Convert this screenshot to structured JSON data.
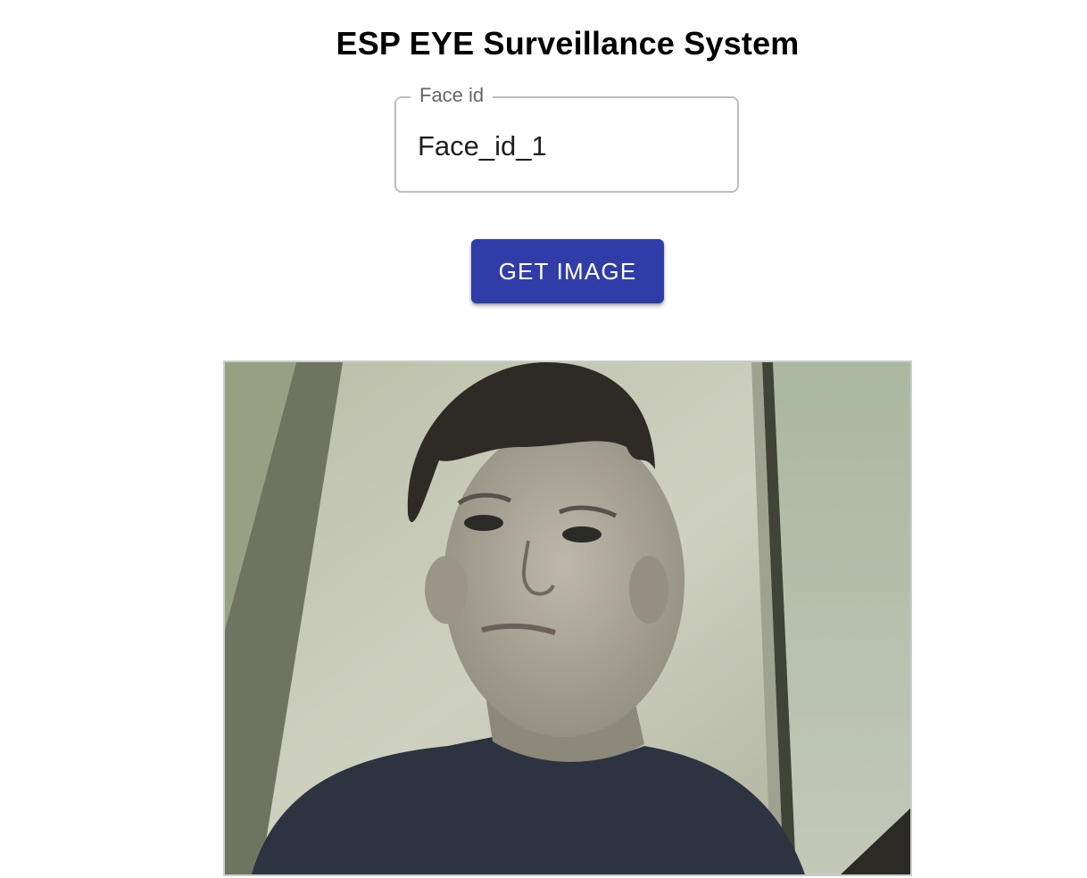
{
  "header": {
    "title": "ESP EYE Surveillance System"
  },
  "face_id_field": {
    "label": "Face id",
    "value": "Face_id_1"
  },
  "actions": {
    "get_image_label": "GET IMAGE"
  },
  "colors": {
    "button": "#303da8",
    "field_border": "#bdbdbd"
  }
}
